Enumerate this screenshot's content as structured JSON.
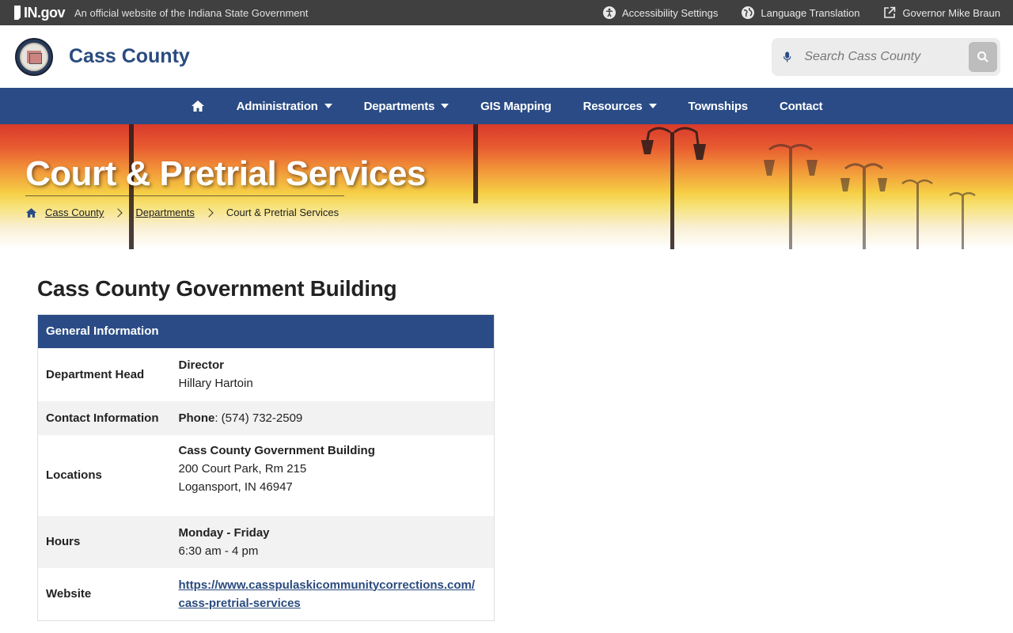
{
  "topbar": {
    "ingov_logo": "IN.gov",
    "official_text": "An official website of the Indiana State Government",
    "links": [
      {
        "label": "Accessibility Settings",
        "icon": "accessibility-icon"
      },
      {
        "label": "Language Translation",
        "icon": "globe-icon"
      },
      {
        "label": "Governor Mike Braun",
        "icon": "external-link-icon"
      }
    ]
  },
  "header": {
    "site_title": "Cass County",
    "search_placeholder": "Search Cass County"
  },
  "nav": {
    "items": [
      {
        "label": "Administration",
        "dropdown": true
      },
      {
        "label": "Departments",
        "dropdown": true
      },
      {
        "label": "GIS Mapping",
        "dropdown": false
      },
      {
        "label": "Resources",
        "dropdown": true
      },
      {
        "label": "Townships",
        "dropdown": false
      },
      {
        "label": "Contact",
        "dropdown": false
      }
    ]
  },
  "hero": {
    "title": "Court & Pretrial Services",
    "breadcrumb": [
      "Cass County",
      "Departments",
      "Court & Pretrial Services"
    ]
  },
  "main": {
    "heading": "Cass County Government Building",
    "table": {
      "header": "General Information",
      "rows": {
        "department_head": {
          "label": "Department Head",
          "line1": "Director",
          "line2": "Hillary Hartoin"
        },
        "contact": {
          "label": "Contact Information",
          "phone_label": "Phone",
          "phone": ": (574) 732-2509"
        },
        "locations": {
          "label": "Locations",
          "line1": "Cass County Government Building",
          "line2": "200 Court Park, Rm 215",
          "line3": "Logansport, IN 46947"
        },
        "hours": {
          "label": "Hours",
          "line1": "Monday - Friday",
          "line2": "6:30 am - 4 pm"
        },
        "website": {
          "label": "Website",
          "line1": "https://www.casspulaskicommunitycorrections.com/",
          "line2": "cass-pretrial-services"
        }
      }
    }
  },
  "colors": {
    "nav_bg": "#2a4b85",
    "topbar_bg": "#404040",
    "title_blue": "#2a4b7f"
  }
}
